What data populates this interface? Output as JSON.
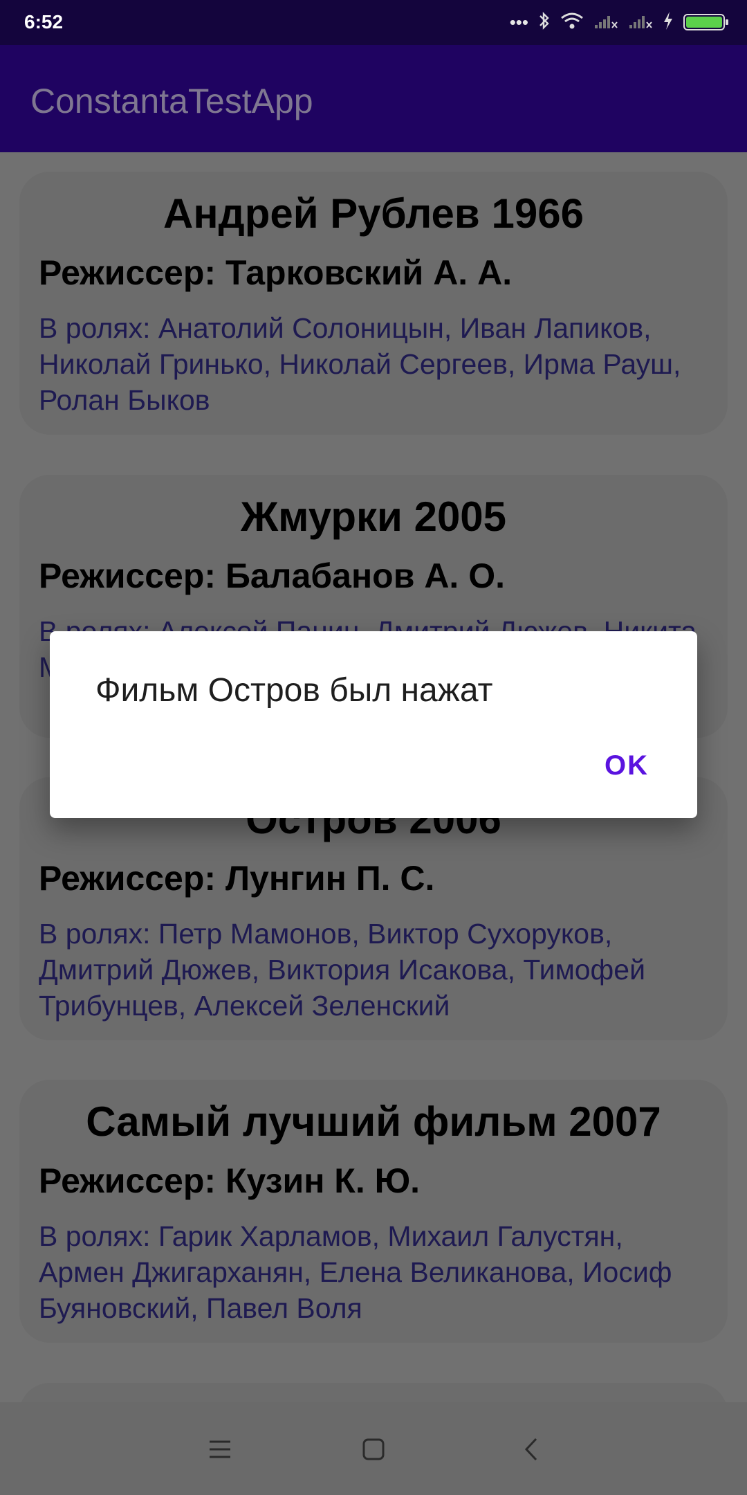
{
  "status_bar": {
    "time": "6:52",
    "icons": [
      "more-dots-icon",
      "bluetooth-icon",
      "wifi-icon",
      "signal-icon",
      "signal-icon",
      "charging-icon",
      "battery-icon"
    ],
    "battery_color": "#5cd14b"
  },
  "app_bar": {
    "title": "ConstantaTestApp",
    "background": "#1f0361"
  },
  "movies": [
    {
      "title": "Андрей Рублев 1966",
      "director": "Режиссер: Тарковский А. А.",
      "cast": "В ролях: Анатолий Солоницын, Иван Лапиков, Николай Гринько, Николай Сергеев, Ирма Рауш, Ролан Быков"
    },
    {
      "title": "Жмурки 2005",
      "director": "Режиссер: Балабанов А. О.",
      "cast": "В ролях: Алексей Панин, Дмитрий Дюжев, Никита Михалков"
    },
    {
      "title": "Остров 2006",
      "director": "Режиссер: Лунгин П. С.",
      "cast": "В ролях: Петр Мамонов, Виктор Сухоруков, Дмитрий Дюжев, Виктория Исакова, Тимофей Трибунцев, Алексей Зеленский"
    },
    {
      "title": "Самый лучший фильм 2007",
      "director": "Режиссер: Кузин К. Ю.",
      "cast": "В ролях: Гарик Харламов, Михаил Галустян, Армен Джигарханян, Елена Великанова, Иосиф Буяновский, Павел Воля"
    }
  ],
  "dialog": {
    "message": "Фильм Остров был нажат",
    "ok_label": "OK",
    "accent": "#5a13df"
  },
  "nav_bar": {
    "icons": [
      "menu-icon",
      "home-icon",
      "back-icon"
    ]
  }
}
